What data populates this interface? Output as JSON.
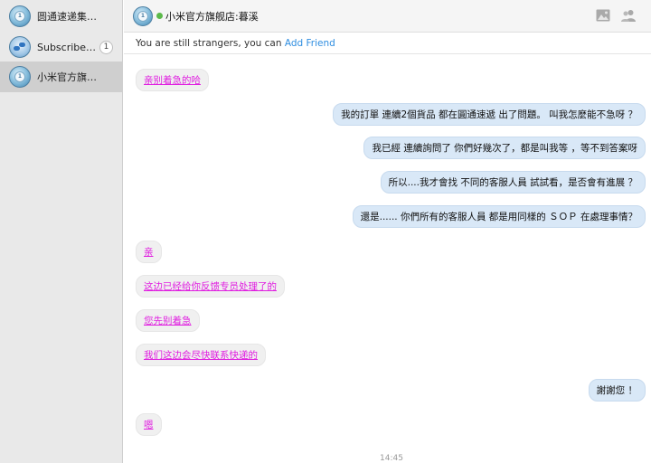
{
  "sidebar": {
    "conversations": [
      {
        "label": "圆通速递集…",
        "badge": ""
      },
      {
        "label": "Subscribe…",
        "badge": "1"
      },
      {
        "label": "小米官方旗…",
        "badge": ""
      }
    ]
  },
  "header": {
    "title": "小米官方旗舰店:暮溪",
    "icons": [
      "picture-icon",
      "group-icon"
    ]
  },
  "notice": {
    "text": "You are still strangers, you can ",
    "link": "Add Friend"
  },
  "messages": [
    {
      "side": "in",
      "text": "亲别着急的哈"
    },
    {
      "side": "out",
      "text": "我的訂單 連續2個貨品 都在圓通速遞 出了問題。 叫我怎麼能不急呀 ？"
    },
    {
      "side": "out",
      "text": "我已經 連續詢問了 你們好幾次了，都是叫我等 ，等不到答案呀"
    },
    {
      "side": "out",
      "text": "所以....我才會找 不同的客服人員 試試看，是否會有進展 ？"
    },
    {
      "side": "out",
      "text": "還是...... 你們所有的客服人員 都是用同樣的 ＳＯＰ 在處理事情？"
    },
    {
      "side": "in",
      "text": "亲"
    },
    {
      "side": "in",
      "text": "这边已经给你反馈专员处理了的"
    },
    {
      "side": "in",
      "text": "您先别着急"
    },
    {
      "side": "in",
      "text": "我们这边会尽快联系快递的"
    },
    {
      "side": "out",
      "text": "謝謝您 ！"
    },
    {
      "side": "in",
      "text": "嗯"
    }
  ],
  "timestamp": "14:45",
  "colors": {
    "incoming_link": "#e01ee0",
    "outgoing_bubble": "#d9e8f7",
    "link": "#2e8de0",
    "online": "#5bb94a"
  }
}
